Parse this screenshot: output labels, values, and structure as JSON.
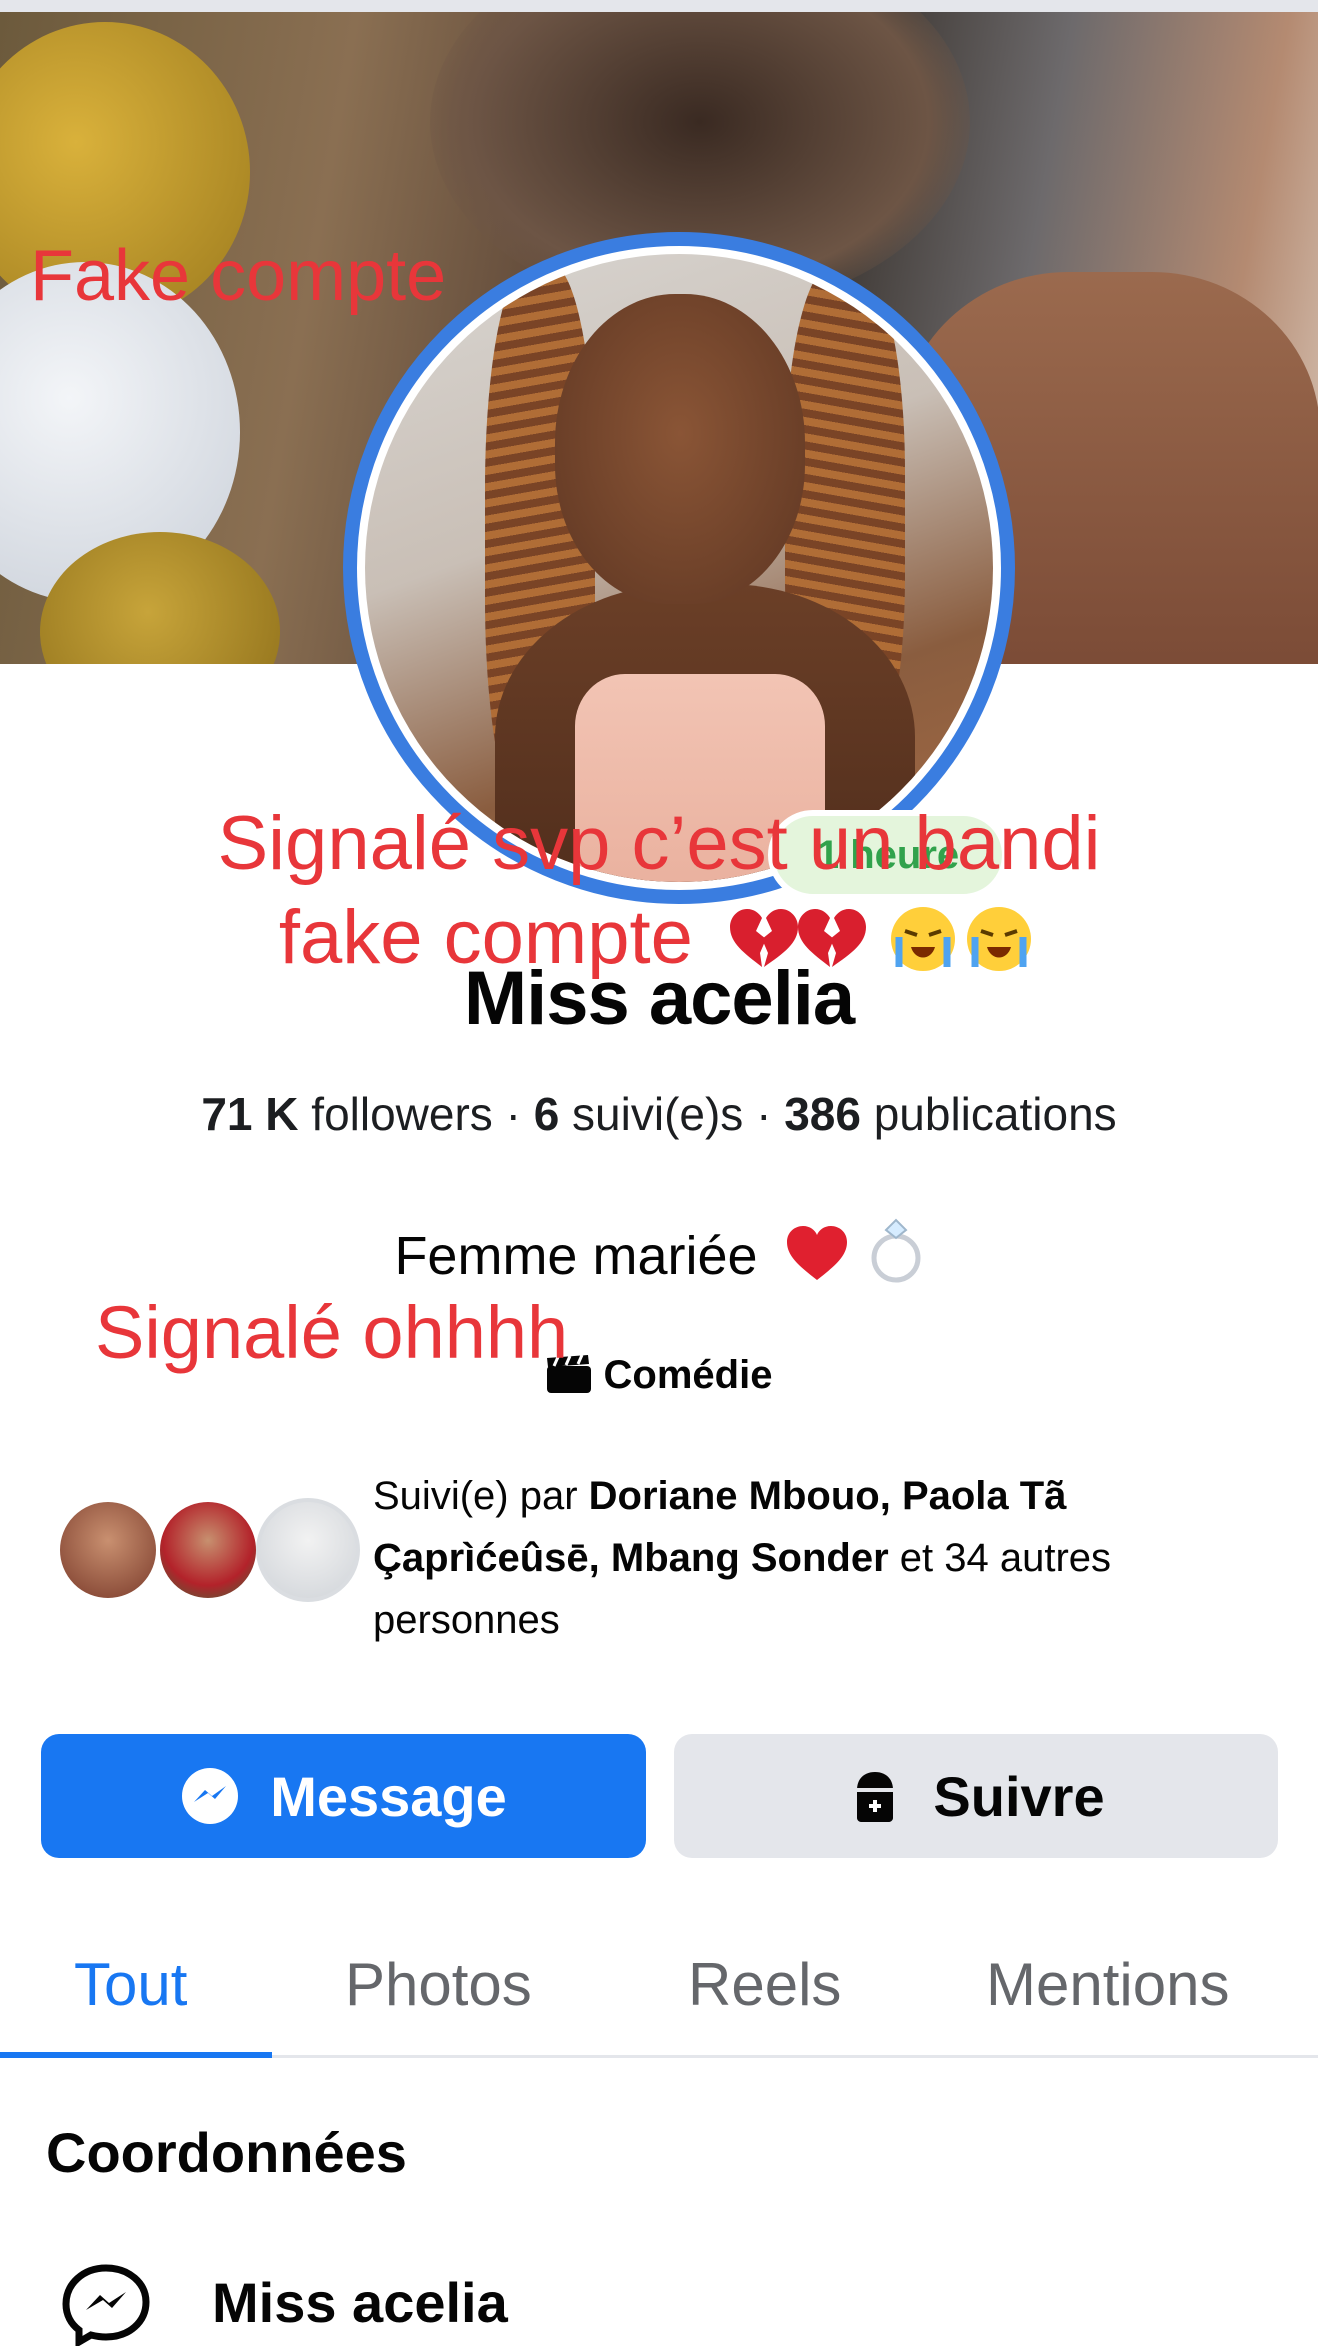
{
  "overlay": {
    "top_label": "Fake compte",
    "middle_line1": "Signalé svp c’est un bandi",
    "middle_line2": "fake compte",
    "lower_label": "Signalé ohhhh"
  },
  "profile": {
    "online_badge": "1 heure",
    "name": "Miss acelia",
    "stats": {
      "followers_count": "71 K",
      "followers_label": " followers · ",
      "following_count": "6",
      "following_label": " suivi(e)s · ",
      "posts_count": "386",
      "posts_label": " publications"
    },
    "bio": "Femme mariée",
    "category": "Comédie",
    "followed_by": {
      "prefix": "Suivi(e) par ",
      "names": "Doriane Mbouo, Paola Tã Çaprìćeûsē, Mbang Sonder",
      "suffix": " et 34 autres personnes"
    }
  },
  "actions": {
    "message_label": "Message",
    "follow_label": "Suivre"
  },
  "tabs": [
    {
      "label": "Tout",
      "active": true
    },
    {
      "label": "Photos",
      "active": false
    },
    {
      "label": "Reels",
      "active": false
    },
    {
      "label": "Mentions",
      "active": false
    }
  ],
  "contact": {
    "section_title": "Coordonnées",
    "messenger_name": "Miss acelia"
  },
  "colors": {
    "primary": "#1877f2",
    "overlay_text": "#e8363a",
    "button_secondary": "#e4e6eb"
  }
}
